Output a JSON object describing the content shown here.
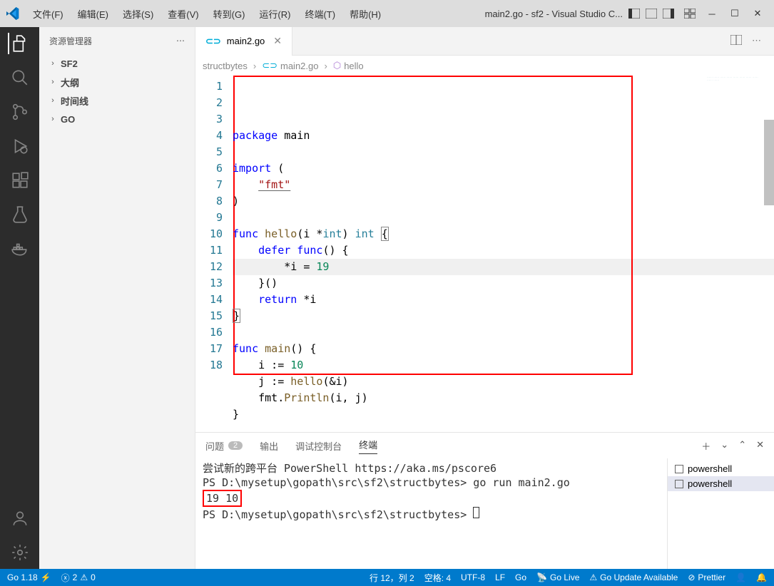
{
  "titlebar": {
    "menus": [
      "文件(F)",
      "编辑(E)",
      "选择(S)",
      "查看(V)",
      "转到(G)",
      "运行(R)",
      "终端(T)",
      "帮助(H)"
    ],
    "title": "main2.go - sf2 - Visual Studio C..."
  },
  "sidebar": {
    "header": "资源管理器",
    "items": [
      "SF2",
      "大纲",
      "时间线",
      "GO"
    ]
  },
  "tabs": {
    "file_icon": "∞",
    "file_name": "main2.go"
  },
  "breadcrumb": {
    "root": "structbytes",
    "file": "main2.go",
    "symbol": "hello"
  },
  "minimap_hint": "……\n……\n……\n……\n……\n……\n……\n……\n……\n……",
  "code": {
    "line_numbers": [
      "1",
      "2",
      "3",
      "4",
      "5",
      "6",
      "7",
      "8",
      "9",
      "10",
      "11",
      "12",
      "13",
      "14",
      "15",
      "16",
      "17",
      "18"
    ],
    "lines": [
      [
        {
          "t": "package ",
          "c": "kw"
        },
        {
          "t": "main",
          "c": ""
        }
      ],
      [
        {
          "t": "",
          "c": ""
        }
      ],
      [
        {
          "t": "import ",
          "c": "kw"
        },
        {
          "t": "(",
          "c": ""
        }
      ],
      [
        {
          "t": "    ",
          "c": ""
        },
        {
          "t": "\"fmt\"",
          "c": "str fmt-u"
        }
      ],
      [
        {
          "t": ")",
          "c": ""
        }
      ],
      [
        {
          "t": "",
          "c": ""
        }
      ],
      [
        {
          "t": "func ",
          "c": "kw"
        },
        {
          "t": "hello",
          "c": "fn"
        },
        {
          "t": "(i *",
          "c": ""
        },
        {
          "t": "int",
          "c": "typ"
        },
        {
          "t": ") ",
          "c": ""
        },
        {
          "t": "int",
          "c": "typ"
        },
        {
          "t": " {",
          "c": ""
        }
      ],
      [
        {
          "t": "    ",
          "c": ""
        },
        {
          "t": "defer func",
          "c": "kw"
        },
        {
          "t": "() {",
          "c": ""
        }
      ],
      [
        {
          "t": "        *i = ",
          "c": ""
        },
        {
          "t": "19",
          "c": "num"
        }
      ],
      [
        {
          "t": "    }()",
          "c": ""
        }
      ],
      [
        {
          "t": "    ",
          "c": ""
        },
        {
          "t": "return",
          "c": "kw"
        },
        {
          "t": " *i",
          "c": ""
        }
      ],
      [
        {
          "t": "}",
          "c": ""
        }
      ],
      [
        {
          "t": "",
          "c": ""
        }
      ],
      [
        {
          "t": "func ",
          "c": "kw"
        },
        {
          "t": "main",
          "c": "fn"
        },
        {
          "t": "() {",
          "c": ""
        }
      ],
      [
        {
          "t": "    i := ",
          "c": ""
        },
        {
          "t": "10",
          "c": "num"
        }
      ],
      [
        {
          "t": "    j := ",
          "c": ""
        },
        {
          "t": "hello",
          "c": "fn"
        },
        {
          "t": "(&i)",
          "c": ""
        }
      ],
      [
        {
          "t": "    fmt.",
          "c": ""
        },
        {
          "t": "Println",
          "c": "fn"
        },
        {
          "t": "(i, j)",
          "c": ""
        }
      ],
      [
        {
          "t": "}",
          "c": ""
        }
      ]
    ]
  },
  "panel": {
    "tabs": {
      "problems": "问题",
      "problems_count": "2",
      "output": "输出",
      "debug": "调试控制台",
      "terminal": "终端"
    },
    "terminal_lines": [
      "尝试新的跨平台 PowerShell https://aka.ms/pscore6",
      "",
      "PS D:\\mysetup\\gopath\\src\\sf2\\structbytes> go run main2.go"
    ],
    "terminal_output": "19 10",
    "terminal_prompt": "PS D:\\mysetup\\gopath\\src\\sf2\\structbytes> ",
    "terminals": [
      "powershell",
      "powershell"
    ]
  },
  "status": {
    "go_version": "Go 1.18",
    "errors": "2",
    "warnings": "0",
    "line_col": "行 12，列 2",
    "spaces": "空格: 4",
    "encoding": "UTF-8",
    "eol": "LF",
    "lang": "Go",
    "golive": "Go Live",
    "go_update": "Go Update Available",
    "prettier": "Prettier"
  }
}
